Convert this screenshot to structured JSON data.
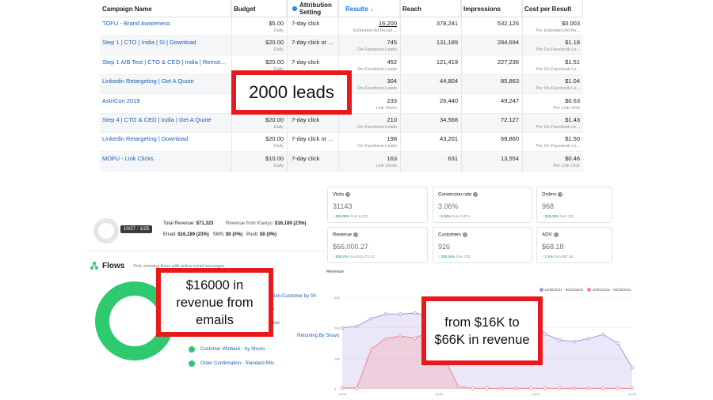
{
  "ads_table": {
    "headers": {
      "campaign": "Campaign Name",
      "budget": "Budget",
      "attribution": "Attribution Setting",
      "results": "Results ↓",
      "reach": "Reach",
      "impressions": "Impressions",
      "cpr": "Cost per Result"
    },
    "rows": [
      {
        "name": "TOFU - Brand Awareness",
        "budget": "$5.00",
        "budget_sub": "Daily",
        "attr": "7-day click",
        "results": "16,200",
        "results_sub": "Estimated Ad Recall ...",
        "reach": "378,241",
        "impressions": "532,126",
        "cpr": "$0.003",
        "cpr_sub": "Per Estimated Ad Re..."
      },
      {
        "name": "Step 1 | CTO | India | SI | Download",
        "budget": "$20.00",
        "budget_sub": "Daily",
        "attr": "7-day click or ...",
        "results": "745",
        "results_sub": "On-Facebook Leads",
        "reach": "131,189",
        "impressions": "284,694",
        "cpr": "$1.18",
        "cpr_sub": "Per On-Facebook Le..."
      },
      {
        "name": "Step 1 A/B Test | CTO & CEO | India | Remote ...",
        "budget": "$20.00",
        "budget_sub": "Daily",
        "attr": "7-day click",
        "results": "452",
        "results_sub": "On-Facebook Leads",
        "reach": "121,419",
        "impressions": "227,236",
        "cpr": "$1.51",
        "cpr_sub": "Per On-Facebook Le..."
      },
      {
        "name": "Linkedin Retargeting | Get A Quote",
        "budget": "$20.00",
        "budget_sub": "Daily",
        "attr": "7-day click",
        "results": "304",
        "results_sub": "On-Facebook Leads",
        "reach": "44,804",
        "impressions": "85,863",
        "cpr": "$1.04",
        "cpr_sub": "Per On-Facebook Le..."
      },
      {
        "name": "AstriCon 2019",
        "budget": "$20.00",
        "budget_sub": "Daily",
        "attr": "7-day click",
        "results": "233",
        "results_sub": "Link Clicks",
        "reach": "26,440",
        "impressions": "49,247",
        "cpr": "$0.63",
        "cpr_sub": "Per Link Click"
      },
      {
        "name": "Step 4 | CTO & CED | India | Get A Quote",
        "budget": "$20.00",
        "budget_sub": "Daily",
        "attr": "7-day click",
        "results": "210",
        "results_sub": "On-Facebook Leads",
        "reach": "34,568",
        "impressions": "72,127",
        "cpr": "$1.43",
        "cpr_sub": "Per On-Facebook Le..."
      },
      {
        "name": "Linkedin Retargeting | Download",
        "budget": "$20.00",
        "budget_sub": "Daily",
        "attr": "7-day click or ...",
        "results": "198",
        "results_sub": "On-Facebook Leads",
        "reach": "43,201",
        "impressions": "68,860",
        "cpr": "$1.50",
        "cpr_sub": "Per On-Facebook Le..."
      },
      {
        "name": "MOFU - Link Clicks",
        "budget": "$10.00",
        "budget_sub": "Daily",
        "attr": "7-day click",
        "results": "163",
        "results_sub": "Link Clicks",
        "reach": "631",
        "impressions": "13,554",
        "cpr": "$0.46",
        "cpr_sub": "Per Link Click"
      }
    ]
  },
  "callouts": {
    "leads": "2000 leads",
    "emails": "$16000 in revenue from emails",
    "growth": "from $16K to $66K in revenue"
  },
  "klaviyo": {
    "date_range": "10/27 - 1/25",
    "total_revenue_label": "Total Revenue:",
    "total_revenue": "$71,323",
    "from_klaviyo_label": "Revenue from Klaviyo:",
    "from_klaviyo": "$16,189 (23%)",
    "email_label": "Email:",
    "email_value": "$16,189 (23%)",
    "sms_label": "SMS:",
    "sms_value": "$0 (0%)",
    "push_label": "Push:",
    "push_value": "$0 (0%)",
    "flows_title": "Flows",
    "flows_subtitle": "Only showing flows with active email messages",
    "flow_items": [
      "Non-Customer by Sh",
      "Returning By Shuvo",
      "Customer Winback - by Shuvo",
      "Order Confirmation - Standard-Rits"
    ],
    "flow_partial": [
      "p",
      "uvo"
    ],
    "accent_color": "#2fc96f"
  },
  "shopify": {
    "cards": [
      {
        "label": "Visits",
        "value": "31143",
        "change": "↑ 259.05%",
        "from": "from 8,229"
      },
      {
        "label": "Conversion rate",
        "value": "3.06%",
        "change": "↑ 6.82%",
        "from": "from 2.87%"
      },
      {
        "label": "Orders",
        "value": "968",
        "change": "↑ 325.02%",
        "from": "from 230"
      },
      {
        "label": "Revenue",
        "value": "$66,000.27",
        "change": "↑ 308.2%",
        "from": "from $16,270.33"
      },
      {
        "label": "Customers",
        "value": "926",
        "change": "↑ 336.34%",
        "from": "from 228"
      },
      {
        "label": "AOV",
        "value": "$68.18",
        "change": "↑ 1.4%",
        "from": "from $67.26"
      }
    ],
    "chart_title": "Revenue",
    "legend_a": "12/06/2021 - 06/25/2022",
    "legend_b": "10/01/2021 - 06/25/2021",
    "color_a": "#a990e0",
    "color_b": "#f0868a"
  },
  "chart_data": {
    "type": "area",
    "title": "Revenue",
    "xlabel": "",
    "ylabel": "",
    "yticks": [
      "30K",
      "20K",
      "10K",
      "0"
    ],
    "grid": true,
    "legend_position": "top-right",
    "x_tick_labels": [
      "12/06",
      "12/26",
      "01/09",
      "01/29"
    ],
    "series": [
      {
        "name": "12/06/2021 - 06/25/2022",
        "values": [
          20.0,
          20.5,
          23.0,
          24.5,
          24.5,
          24.8,
          24.0,
          23.0,
          22.8,
          23.2,
          23.0,
          24.4,
          25.0,
          22.5,
          18.0,
          16.0,
          15.5,
          16.5,
          17.8,
          15.0,
          7.0
        ]
      },
      {
        "name": "10/01/2021 - 06/25/2021",
        "values": [
          0.3,
          0.3,
          13.0,
          16.5,
          17.3,
          16.6,
          18.7,
          10.5,
          0.8,
          0.2,
          0.2,
          0.2,
          0.2,
          0.2,
          0.2,
          0.2,
          0.2,
          0.2,
          0.2,
          0.2,
          0.2
        ]
      }
    ],
    "ylim": [
      0,
      30
    ]
  }
}
